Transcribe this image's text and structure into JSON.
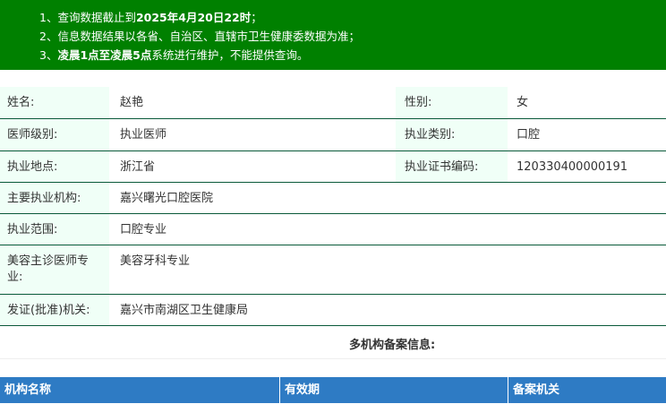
{
  "notice": {
    "lines": [
      {
        "prefix": "1、查询数据截止到",
        "bold": "2025年4月20日22时",
        "suffix": "；"
      },
      {
        "prefix": "2、信息数据结果以各省、自治区、直辖市卫生健康委数据为准；",
        "bold": "",
        "suffix": ""
      },
      {
        "prefix": "3、",
        "bold": "凌晨1点至凌晨5点",
        "suffix": "系统进行维护，不能提供查询。"
      }
    ]
  },
  "info": {
    "name_label": "姓名:",
    "name": "赵艳",
    "gender_label": "性别:",
    "gender": "女",
    "level_label": "医师级别:",
    "level": "执业医师",
    "category_label": "执业类别:",
    "category": "口腔",
    "location_label": "执业地点:",
    "location": "浙江省",
    "cert_label": "执业证书编码:",
    "cert": "120330400000191",
    "org_label": "主要执业机构:",
    "org": "嘉兴曙光口腔医院",
    "scope_label": "执业范围:",
    "scope": "口腔专业",
    "cosmetic_label": "美容主诊医师专业:",
    "cosmetic": "美容牙科专业",
    "issuer_label": "发证(批准)机关:",
    "issuer": "嘉兴市南湖区卫生健康局"
  },
  "multi": {
    "title": "多机构备案信息:",
    "columns": [
      "机构名称",
      "有效期",
      "备案机关"
    ]
  },
  "colors": {
    "notice_bg": "#008000",
    "header_bg": "#2e7bc4",
    "label_bg": "#f0fff7",
    "row_border": "#0a5a3a"
  }
}
